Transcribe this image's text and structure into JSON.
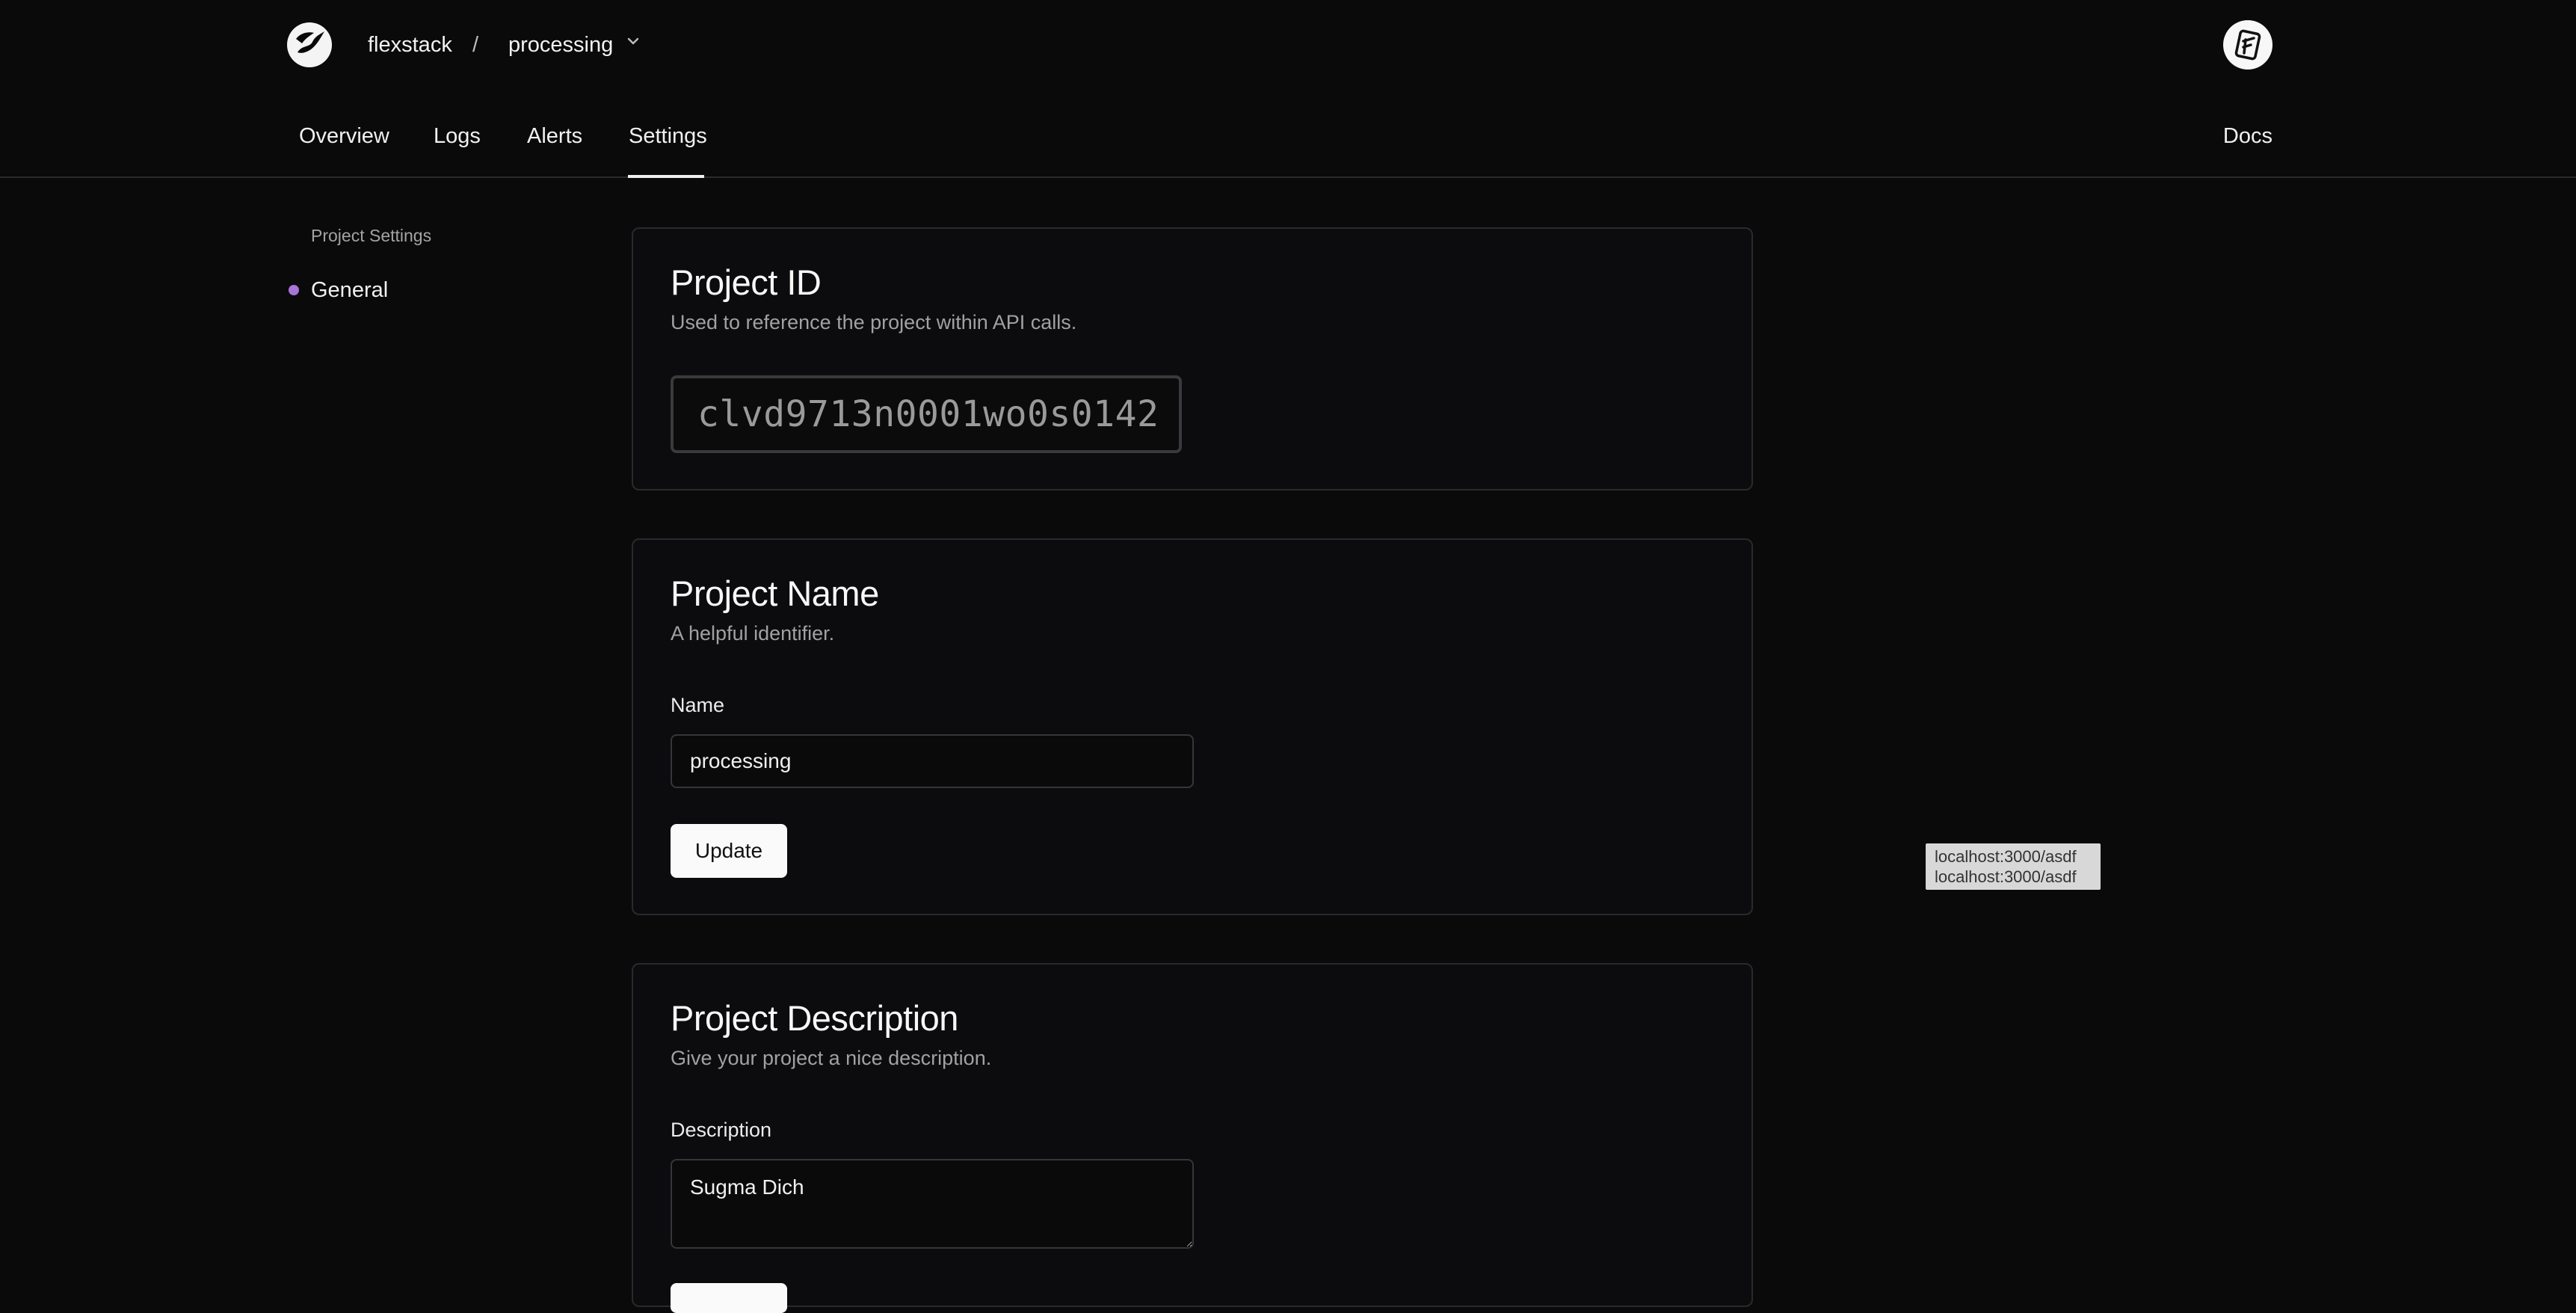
{
  "header": {
    "team": "flexstack",
    "separator": "/",
    "project": "processing",
    "logo_icon": "flexstack-logo-icon",
    "chevron_icon": "chevron-down-icon",
    "avatar_icon": "user-avatar-icon"
  },
  "nav": {
    "tabs": [
      {
        "label": "Overview"
      },
      {
        "label": "Logs"
      },
      {
        "label": "Alerts"
      },
      {
        "label": "Settings"
      }
    ],
    "active_tab": "Settings",
    "docs_label": "Docs"
  },
  "sidebar": {
    "heading": "Project Settings",
    "items": [
      {
        "label": "General",
        "active": true
      }
    ],
    "accent": "#a874d8"
  },
  "cards": {
    "project_id": {
      "title": "Project ID",
      "subtitle": "Used to reference the project within API calls.",
      "value": "clvd9713n0001wo0s0142"
    },
    "project_name": {
      "title": "Project Name",
      "subtitle": "A helpful identifier.",
      "field_label": "Name",
      "value": "processing",
      "button_label": "Update"
    },
    "project_description": {
      "title": "Project Description",
      "subtitle": "Give your project a nice description.",
      "field_label": "Description",
      "value": "Sugma Dich"
    }
  },
  "tooltip": {
    "line1": "localhost:3000/asdf",
    "line2": "localhost:3000/asdf"
  },
  "colors": {
    "background": "#0a0a0b",
    "card_border": "#2a2a2d",
    "button_bg": "#fafafa"
  }
}
